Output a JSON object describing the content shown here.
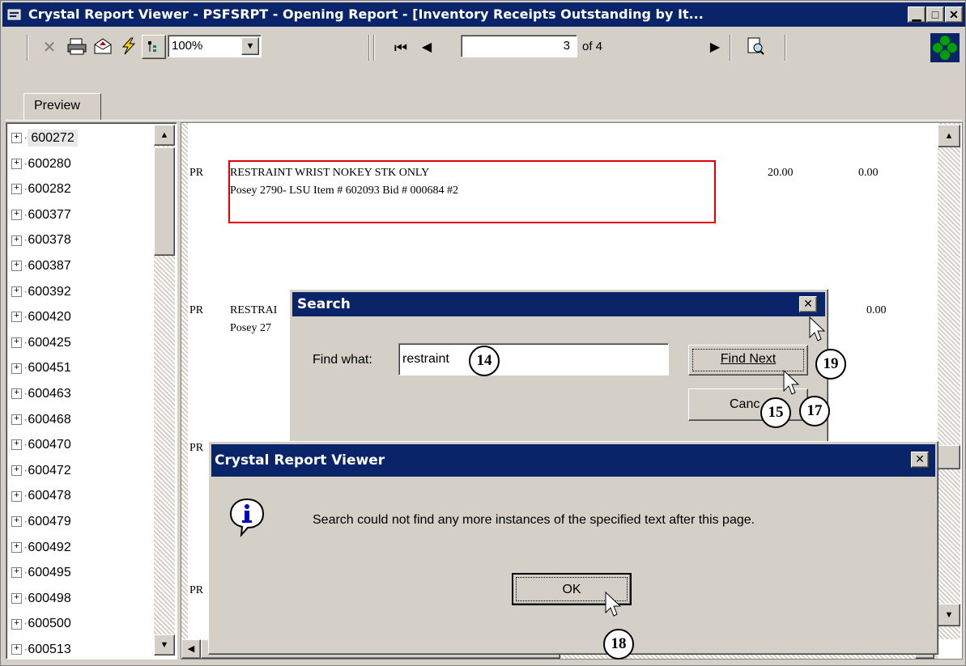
{
  "window": {
    "title": "Crystal Report Viewer - PSFSRPT - Opening Report - [Inventory Receipts Outstanding by It..."
  },
  "toolbar": {
    "zoom_value": "100%",
    "page_current": "3",
    "page_of": "of 4"
  },
  "tabs": {
    "preview": "Preview"
  },
  "tree": {
    "items": [
      "600272",
      "600280",
      "600282",
      "600377",
      "600378",
      "600387",
      "600392",
      "600420",
      "600425",
      "600451",
      "600463",
      "600468",
      "600470",
      "600472",
      "600478",
      "600479",
      "600492",
      "600495",
      "600498",
      "600500",
      "600513"
    ]
  },
  "report": {
    "row1_prefix": "PR",
    "row1_line1": "RESTRAINT WRIST NOKEY STK ONLY",
    "row1_line2": "Posey 2790- LSU Item # 602093 Bid # 000684 #2",
    "row1_qty": "20.00",
    "row1_val": "0.00",
    "row2_prefix": "PR",
    "row2_line1": "RESTRAI",
    "row2_line2": "Posey 27",
    "row2_val": "0.00",
    "row3_prefix": "PR",
    "row4_prefix": "PR"
  },
  "search_dialog": {
    "title": "Search",
    "find_label": "Find what:",
    "find_value": "restraint",
    "find_next": "Find Next",
    "cancel": "Canc"
  },
  "message_dialog": {
    "title": "Crystal Report Viewer",
    "message": "Search could not find any more instances of the specified text after this page.",
    "ok": "OK"
  },
  "callouts": {
    "c14": "14",
    "c15": "15",
    "c17": "17",
    "c18": "18",
    "c19": "19"
  },
  "colors": {
    "titlebar": "#0a246a",
    "face": "#d4d0c8",
    "highlight_box": "#e00000"
  }
}
